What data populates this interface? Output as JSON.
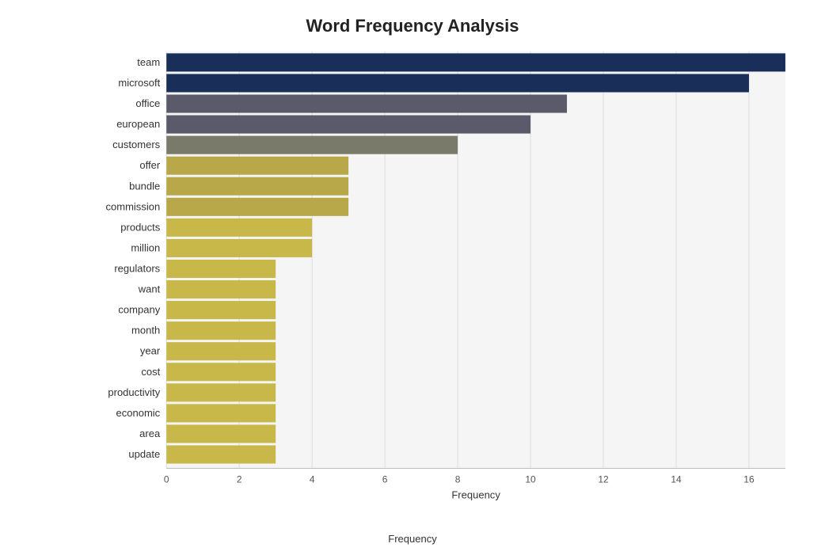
{
  "title": "Word Frequency Analysis",
  "x_axis_label": "Frequency",
  "bars": [
    {
      "label": "team",
      "value": 17,
      "color": "#1a2e5a"
    },
    {
      "label": "microsoft",
      "value": 16,
      "color": "#1a2e5a"
    },
    {
      "label": "office",
      "value": 11,
      "color": "#5a5a6a"
    },
    {
      "label": "european",
      "value": 10,
      "color": "#5a5a6a"
    },
    {
      "label": "customers",
      "value": 8,
      "color": "#7a7a6a"
    },
    {
      "label": "offer",
      "value": 5,
      "color": "#b8a84a"
    },
    {
      "label": "bundle",
      "value": 5,
      "color": "#b8a84a"
    },
    {
      "label": "commission",
      "value": 5,
      "color": "#b8a84a"
    },
    {
      "label": "products",
      "value": 4,
      "color": "#c8b84a"
    },
    {
      "label": "million",
      "value": 4,
      "color": "#c8b84a"
    },
    {
      "label": "regulators",
      "value": 3,
      "color": "#c8b84a"
    },
    {
      "label": "want",
      "value": 3,
      "color": "#c8b84a"
    },
    {
      "label": "company",
      "value": 3,
      "color": "#c8b84a"
    },
    {
      "label": "month",
      "value": 3,
      "color": "#c8b84a"
    },
    {
      "label": "year",
      "value": 3,
      "color": "#c8b84a"
    },
    {
      "label": "cost",
      "value": 3,
      "color": "#c8b84a"
    },
    {
      "label": "productivity",
      "value": 3,
      "color": "#c8b84a"
    },
    {
      "label": "economic",
      "value": 3,
      "color": "#c8b84a"
    },
    {
      "label": "area",
      "value": 3,
      "color": "#c8b84a"
    },
    {
      "label": "update",
      "value": 3,
      "color": "#c8b84a"
    }
  ],
  "x_ticks": [
    0,
    2,
    4,
    6,
    8,
    10,
    12,
    14,
    16
  ],
  "max_value": 17
}
